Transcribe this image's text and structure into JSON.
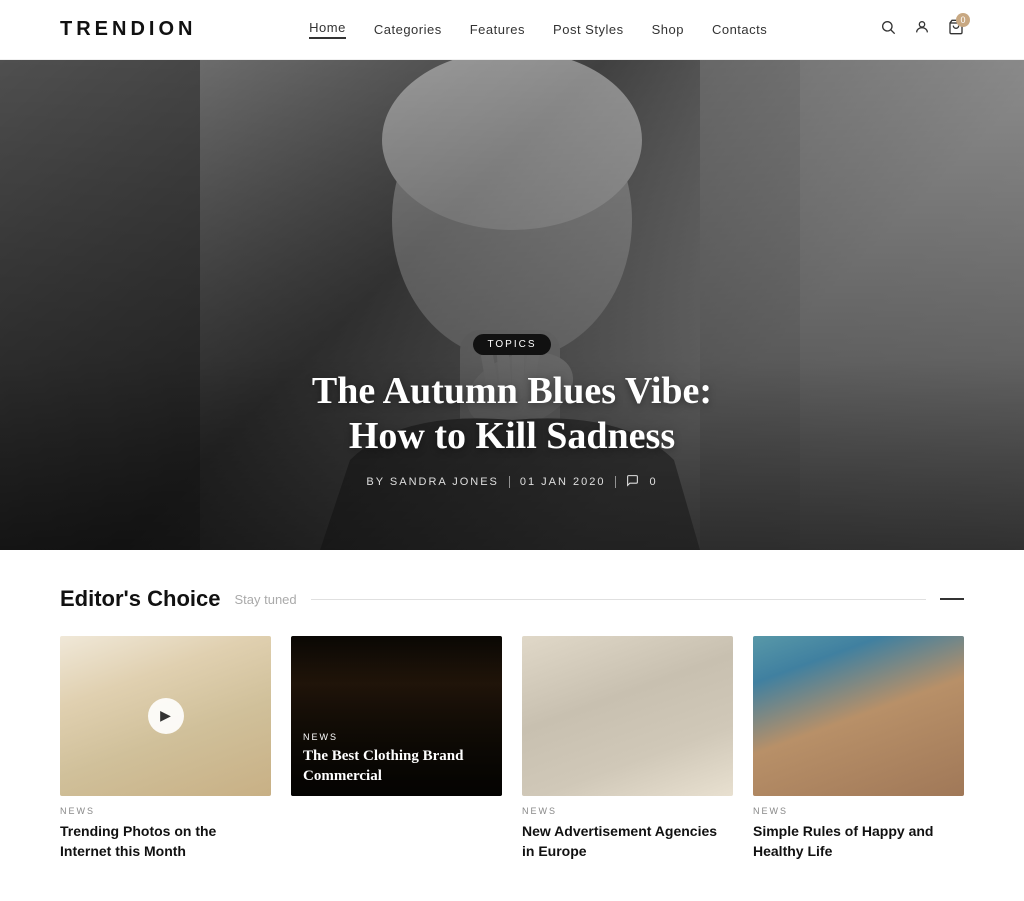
{
  "header": {
    "logo": "TRENDION",
    "nav": [
      {
        "label": "Home",
        "active": true
      },
      {
        "label": "Categories",
        "active": false
      },
      {
        "label": "Features",
        "active": false
      },
      {
        "label": "Post Styles",
        "active": false
      },
      {
        "label": "Shop",
        "active": false
      },
      {
        "label": "Contacts",
        "active": false
      }
    ],
    "cart_count": "0"
  },
  "hero": {
    "badge": "TOPICS",
    "title_line1": "The Autumn Blues Vibe:",
    "title_line2": "How to Kill Sadness",
    "author_label": "BY SANDRA JONES",
    "date": "01 JAN 2020",
    "comments": "0"
  },
  "editors_section": {
    "title": "Editor's Choice",
    "subtitle": "Stay tuned"
  },
  "cards": [
    {
      "id": 1,
      "category": "NEWS",
      "title": "Trending Photos on the Internet this Month",
      "has_overlay": false,
      "has_play": true,
      "img_class": "img-1"
    },
    {
      "id": 2,
      "category": "NEWS",
      "title": "The Best Clothing Brand Commercial",
      "has_overlay": true,
      "has_play": false,
      "img_class": "img-2"
    },
    {
      "id": 3,
      "category": "NEWS",
      "title": "New Advertisement Agencies in Europe",
      "has_overlay": false,
      "has_play": false,
      "img_class": "img-3"
    },
    {
      "id": 4,
      "category": "NEWS",
      "title": "Simple Rules of Happy and Healthy Life",
      "has_overlay": false,
      "has_play": false,
      "img_class": "img-4"
    }
  ]
}
